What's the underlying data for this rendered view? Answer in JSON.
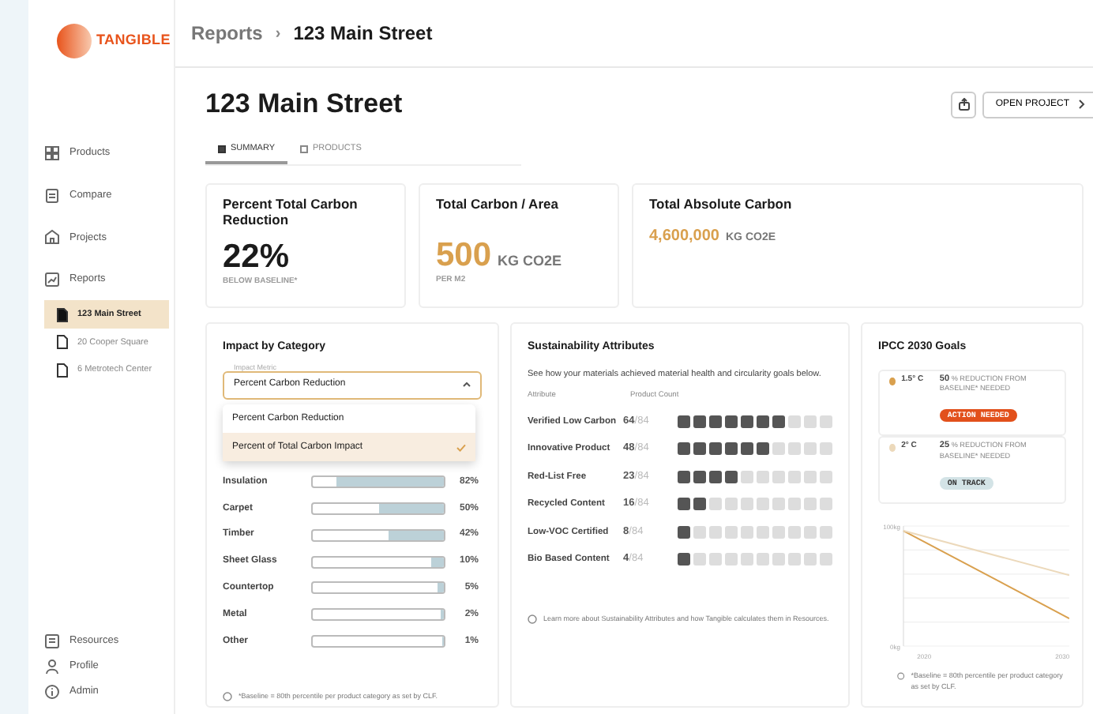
{
  "sidebar": {
    "logo": "TANGIBLE",
    "nav": [
      {
        "label": "Products"
      },
      {
        "label": "Compare"
      },
      {
        "label": "Projects"
      },
      {
        "label": "Reports"
      }
    ],
    "reports": [
      {
        "label": "123 Main Street",
        "selected": true
      },
      {
        "label": "20 Cooper Square",
        "selected": false
      },
      {
        "label": "6 Metrotech Center",
        "selected": false
      }
    ],
    "footer": [
      {
        "label": "Resources"
      },
      {
        "label": "Profile"
      },
      {
        "label": "Admin"
      }
    ]
  },
  "breadcrumb": {
    "parent": "Reports",
    "separator": "›",
    "current": "123 Main Street"
  },
  "title": "123 Main Street",
  "open_project": "OPEN PROJECT",
  "tabs": [
    {
      "label": "SUMMARY",
      "selected": true
    },
    {
      "label": "PRODUCTS",
      "selected": false
    }
  ],
  "metrics": [
    {
      "kind": "percent",
      "title": "Percent Total Carbon Reduction",
      "value": "22%",
      "caption": "BELOW BASELINE*"
    },
    {
      "kind": "large",
      "title": "Total Carbon / Area",
      "value": "500",
      "unit": "KG CO2E",
      "caption": "PER M2"
    },
    {
      "kind": "small",
      "title": "Total Absolute Carbon",
      "value": "4,600,000",
      "unit": "KG CO2E"
    }
  ],
  "impact": {
    "title": "Impact by Category",
    "select_label": "Impact Metric",
    "select_value": "Percent Carbon Reduction",
    "expanded": true,
    "options": [
      {
        "label": "Percent Carbon Reduction",
        "selected": false
      },
      {
        "label": "Percent of Total Carbon Impact",
        "selected": true
      }
    ],
    "categories": [
      {
        "name": "Insulation",
        "level": 0.82,
        "reading": "82%"
      },
      {
        "name": "Carpet",
        "level": 0.5,
        "reading": "50%"
      },
      {
        "name": "Timber",
        "level": 0.42,
        "reading": "42%"
      },
      {
        "name": "Sheet Glass",
        "level": 0.1,
        "reading": "10%"
      },
      {
        "name": "Countertop",
        "level": 0.05,
        "reading": "5%"
      },
      {
        "name": "Metal",
        "level": 0.02,
        "reading": "2%"
      },
      {
        "name": "Other",
        "level": 0.01,
        "reading": "1%"
      }
    ],
    "footnote": "*Baseline = 80th percentile per product category as set by CLF."
  },
  "attributes": {
    "title": "Sustainability Attributes",
    "intro": "See how your materials achieved material health and circularity goals below.",
    "columns": [
      "Attribute",
      "Product Count"
    ],
    "rows": [
      {
        "name": "Verified Low Carbon",
        "count": "64",
        "total": "/84",
        "level": 0.7
      },
      {
        "name": "Innovative Product",
        "count": "48",
        "total": "/84",
        "level": 0.6
      },
      {
        "name": "Red-List Free",
        "count": "23",
        "total": "/84",
        "level": 0.4
      },
      {
        "name": "Recycled Content",
        "count": "16",
        "total": "/84",
        "level": 0.2
      },
      {
        "name": "Low-VOC Certified",
        "count": "8",
        "total": "/84",
        "level": 0.1
      },
      {
        "name": "Bio Based Content",
        "count": "4",
        "total": "/84",
        "level": 0.1
      }
    ],
    "footnote": "Learn more about Sustainability Attributes and how Tangible calculates them in Resources."
  },
  "ipcc": {
    "title": "IPCC 2030 Goals",
    "goals": [
      {
        "name": "1.5° C",
        "color": "#d9a04e",
        "text": "**50** % REDUCTION FROM BASELINE* NEEDED",
        "status": {
          "label": "ACTION NEEDED",
          "color": "#e2501b"
        }
      },
      {
        "name": "2° C",
        "color": "#ecd9bb",
        "text": "**25** % REDUCTION FROM BASELINE* NEEDED",
        "status": {
          "label": "ON TRACK",
          "color": "#d3e3e6"
        }
      }
    ],
    "chart_data": {
      "type": "line",
      "x": [
        2018.5,
        2030.5
      ],
      "xlim": [
        2018.5,
        2030.5
      ],
      "ylim": [
        0,
        100
      ],
      "xticks": [
        2020,
        2030
      ],
      "yticks": [
        {
          "value": 0,
          "label": "0kg"
        },
        {
          "value": 100,
          "label": "100kg"
        }
      ],
      "series": [
        {
          "color": "#d9a04e",
          "values": [
            96,
            23
          ]
        },
        {
          "color": "#ecd9bb",
          "values": [
            96,
            59
          ]
        }
      ]
    },
    "footnote": "*Baseline = 80th percentile per product category as set by CLF."
  }
}
